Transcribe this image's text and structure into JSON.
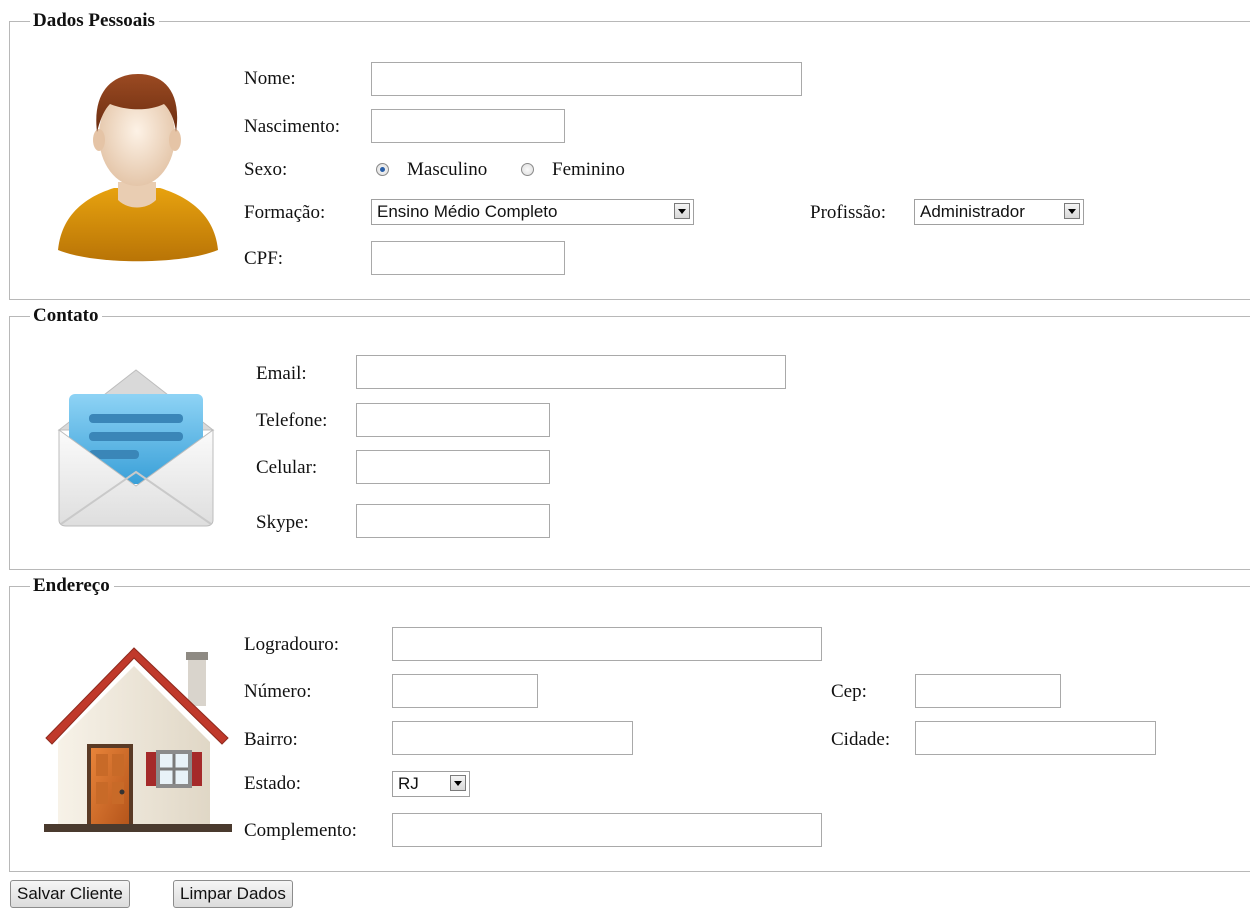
{
  "personal": {
    "legend": "Dados Pessoais",
    "nome_label": "Nome:",
    "nome_value": "",
    "nascimento_label": "Nascimento:",
    "nascimento_value": "",
    "sexo_label": "Sexo:",
    "sexo_options": [
      "Masculino",
      "Feminino"
    ],
    "sexo_selected": "Masculino",
    "formacao_label": "Formação:",
    "formacao_selected": "Ensino Médio Completo",
    "profissao_label": "Profissão:",
    "profissao_selected": "Administrador",
    "cpf_label": "CPF:",
    "cpf_value": "",
    "icon": "user-avatar-icon"
  },
  "contato": {
    "legend": "Contato",
    "email_label": "Email:",
    "telefone_label": "Telefone:",
    "celular_label": "Celular:",
    "skype_label": "Skype:",
    "icon": "envelope-icon"
  },
  "endereco": {
    "legend": "Endereço",
    "logradouro_label": "Logradouro:",
    "numero_label": "Número:",
    "cep_label": "Cep:",
    "bairro_label": "Bairro:",
    "cidade_label": "Cidade:",
    "estado_label": "Estado:",
    "estado_selected": "RJ",
    "complemento_label": "Complemento:",
    "icon": "house-icon"
  },
  "actions": {
    "save_label": "Salvar Cliente",
    "clear_label": "Limpar Dados"
  },
  "colors": {
    "border": "#b8b8b8",
    "shirt": "#d08a10",
    "roof": "#c0392b",
    "door": "#d2691e",
    "envelope_paper": "#5bb7e8"
  }
}
